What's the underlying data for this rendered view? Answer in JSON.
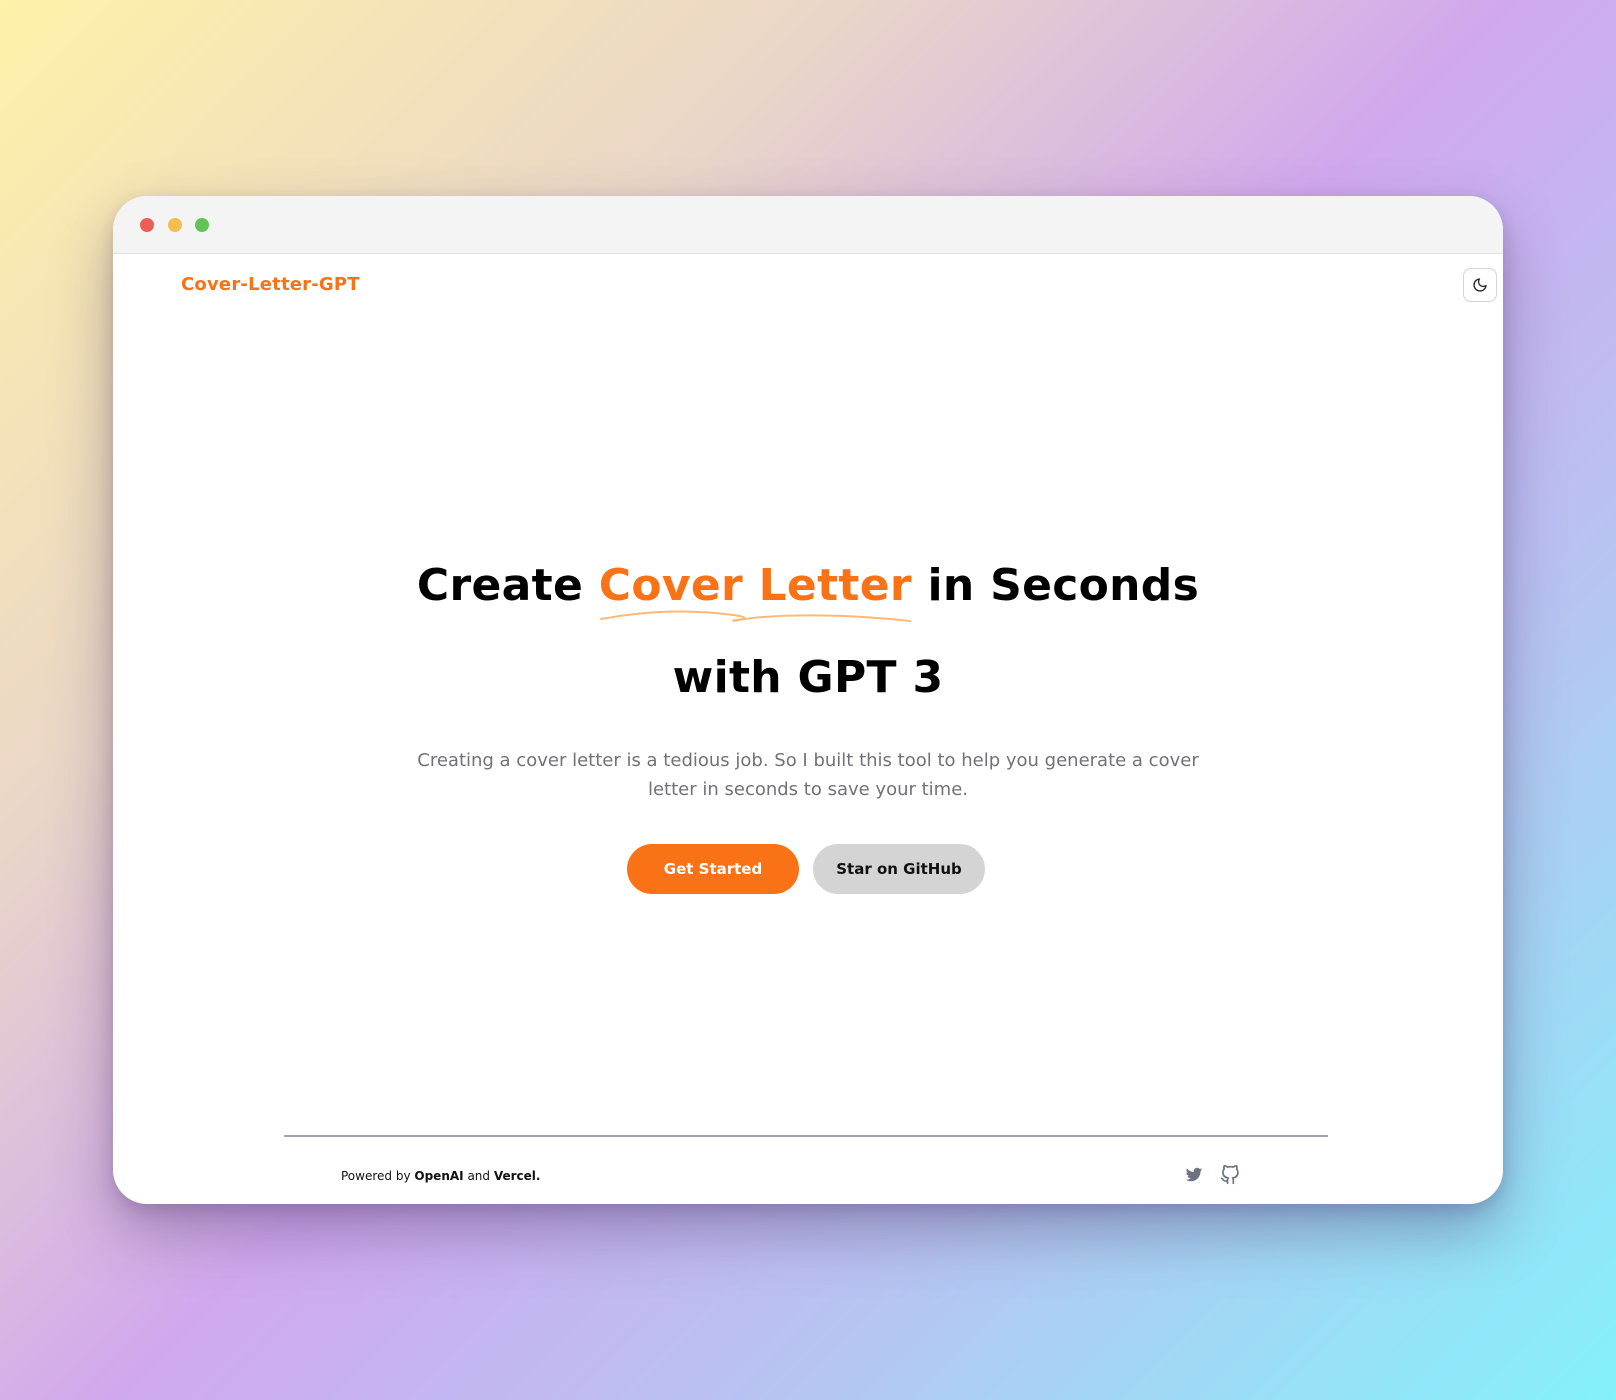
{
  "header": {
    "brand": "Cover-Letter-GPT",
    "theme_toggle_icon": "moon-icon"
  },
  "hero": {
    "title_prefix": "Create ",
    "title_highlight": "Cover Letter",
    "title_suffix": " in Seconds",
    "title_line2": "with GPT 3",
    "subtitle_line1": "Creating a cover letter is a tedious job. So I built this tool to help you generate a cover",
    "subtitle_line2": "letter in seconds to save your time."
  },
  "actions": {
    "primary_label": "Get Started",
    "secondary_label": "Star on GitHub"
  },
  "footer": {
    "powered_by": "Powered by",
    "brand1": "OpenAI",
    "and": "and",
    "brand2": "Vercel",
    "period": ".",
    "icons": [
      "twitter-icon",
      "github-icon"
    ]
  },
  "colors": {
    "accent": "#f97316",
    "secondary_button": "#d4d4d4",
    "subtitle": "#71717a"
  }
}
